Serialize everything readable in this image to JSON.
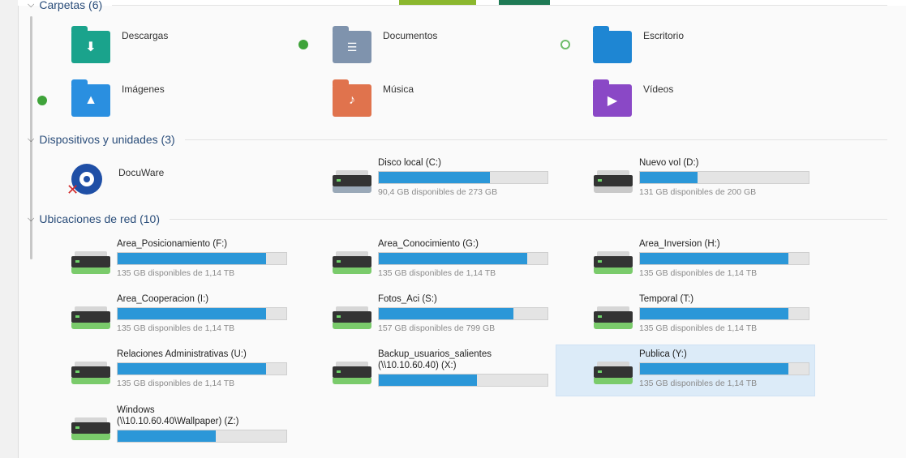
{
  "sections": {
    "carpetas": "Carpetas (6)",
    "dispositivos": "Dispositivos y unidades (3)",
    "red": "Ubicaciones de red (10)"
  },
  "folders": [
    {
      "label": "Descargas",
      "color": "#1aa38c"
    },
    {
      "label": "Documentos",
      "color": "#7f93ad"
    },
    {
      "label": "Escritorio",
      "color": "#1e86d3"
    },
    {
      "label": "Imágenes",
      "color": "#2a8fe0"
    },
    {
      "label": "Música",
      "color": "#e0734d"
    },
    {
      "label": "Vídeos",
      "color": "#8a48c6"
    }
  ],
  "devices": [
    {
      "name": "DocuWare"
    },
    {
      "name": "Disco local (C:)",
      "free": "90,4 GB disponibles de 273 GB",
      "used_pct": 66
    },
    {
      "name": "Nuevo vol (D:)",
      "free": "131 GB disponibles de 200 GB",
      "used_pct": 34
    }
  ],
  "network": [
    {
      "name": "Area_Posicionamiento (F:)",
      "free": "135 GB disponibles de 1,14 TB",
      "used_pct": 88
    },
    {
      "name": "Area_Conocimiento (G:)",
      "free": "135 GB disponibles de 1,14 TB",
      "used_pct": 88
    },
    {
      "name": "Area_Inversion (H:)",
      "free": "135 GB disponibles de 1,14 TB",
      "used_pct": 88
    },
    {
      "name": "Area_Cooperacion (I:)",
      "free": "135 GB disponibles de 1,14 TB",
      "used_pct": 88
    },
    {
      "name": "Fotos_Aci (S:)",
      "free": "157 GB disponibles de 799 GB",
      "used_pct": 80
    },
    {
      "name": "Temporal (T:)",
      "free": "135 GB disponibles de 1,14 TB",
      "used_pct": 88
    },
    {
      "name": "Relaciones Administrativas (U:)",
      "free": "135 GB disponibles de 1,14 TB",
      "used_pct": 88
    },
    {
      "name": "Backup_usuarios_salientes",
      "name2": "(\\\\10.10.60.40) (X:)",
      "used_pct": 58
    },
    {
      "name": "Publica (Y:)",
      "free": "135 GB disponibles de 1,14 TB",
      "used_pct": 88
    },
    {
      "name": "Windows",
      "name2": "(\\\\10.10.60.40\\Wallpaper) (Z:)",
      "used_pct": 58
    }
  ]
}
